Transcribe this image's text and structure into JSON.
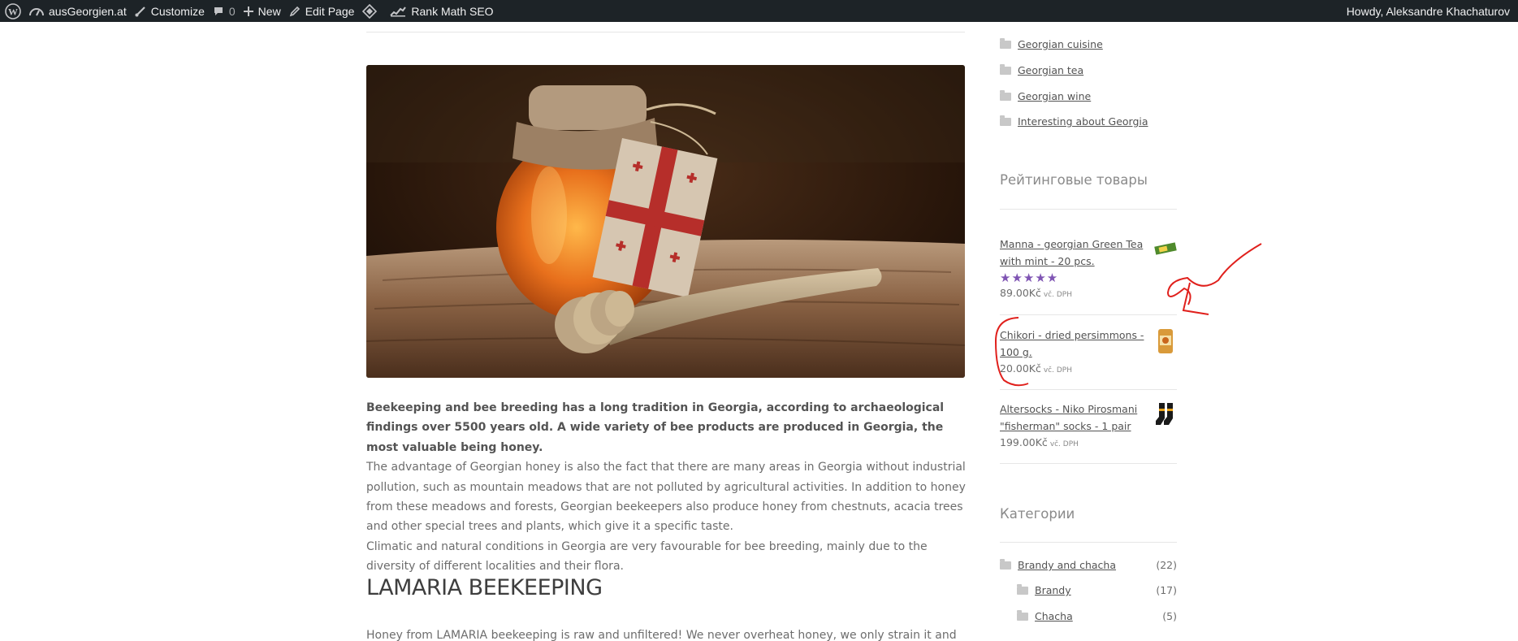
{
  "adminbar": {
    "site_name": "ausGeorgien.at",
    "customize": "Customize",
    "comments_count": "0",
    "new": "New",
    "edit_page": "Edit Page",
    "rank_math": "Rank Math SEO",
    "howdy": "Howdy, Aleksandre Khachaturov",
    "bg_color": "#1d2327"
  },
  "sidebar": {
    "top_categories": [
      {
        "label": "Georgian cuisine"
      },
      {
        "label": "Georgian tea"
      },
      {
        "label": "Georgian wine"
      },
      {
        "label": "Interesting about Georgia"
      }
    ],
    "rated_title": "Рейтинговые товары",
    "products": [
      {
        "name": "Manna - georgian Green Tea with mint - 20 pcs.",
        "rating": 5,
        "stars": "★★★★★",
        "price": "89.00Kč",
        "tax": "vč. DPH"
      },
      {
        "name": "Chikori - dried persimmons - 100 g.",
        "price": "20.00Kč",
        "tax": "vč. DPH"
      },
      {
        "name": "Altersocks - Niko Pirosmani \"fisherman\" socks - 1 pair",
        "price": "199.00Kč",
        "tax": "vč. DPH"
      }
    ],
    "categories_title": "Категории",
    "categories": [
      {
        "label": "Brandy and chacha",
        "count": "(22)"
      },
      {
        "label": "Brandy",
        "count": "(17)"
      },
      {
        "label": "Chacha",
        "count": "(5)"
      }
    ]
  },
  "article": {
    "lead": "Beekeeping and bee breeding has a long tradition in Georgia, according to archaeological findings over 5500 years old. A wide variety of bee products are produced in Georgia, the most valuable being honey.",
    "p1": "The advantage of Georgian honey is also the fact that there are many areas in Georgia without industrial pollution, such as mountain meadows that are not polluted by agricultural activities. In addition to honey from these meadows and forests, Georgian beekeepers also produce honey from chestnuts, acacia trees and other special trees and plants, which give it a specific taste.",
    "p2": "Climatic and natural conditions in Georgia are very favourable for bee breeding, mainly due to the diversity of different localities and their flora.",
    "heading": "LAMARIA BEEKEEPING",
    "p3": "Honey from LAMARIA beekeeping is raw and unfiltered! We never overheat honey, we only strain it and remove large"
  },
  "colors": {
    "accent_purple": "#7f54b3",
    "annotation_red": "#e0201c",
    "link": "#535353"
  }
}
